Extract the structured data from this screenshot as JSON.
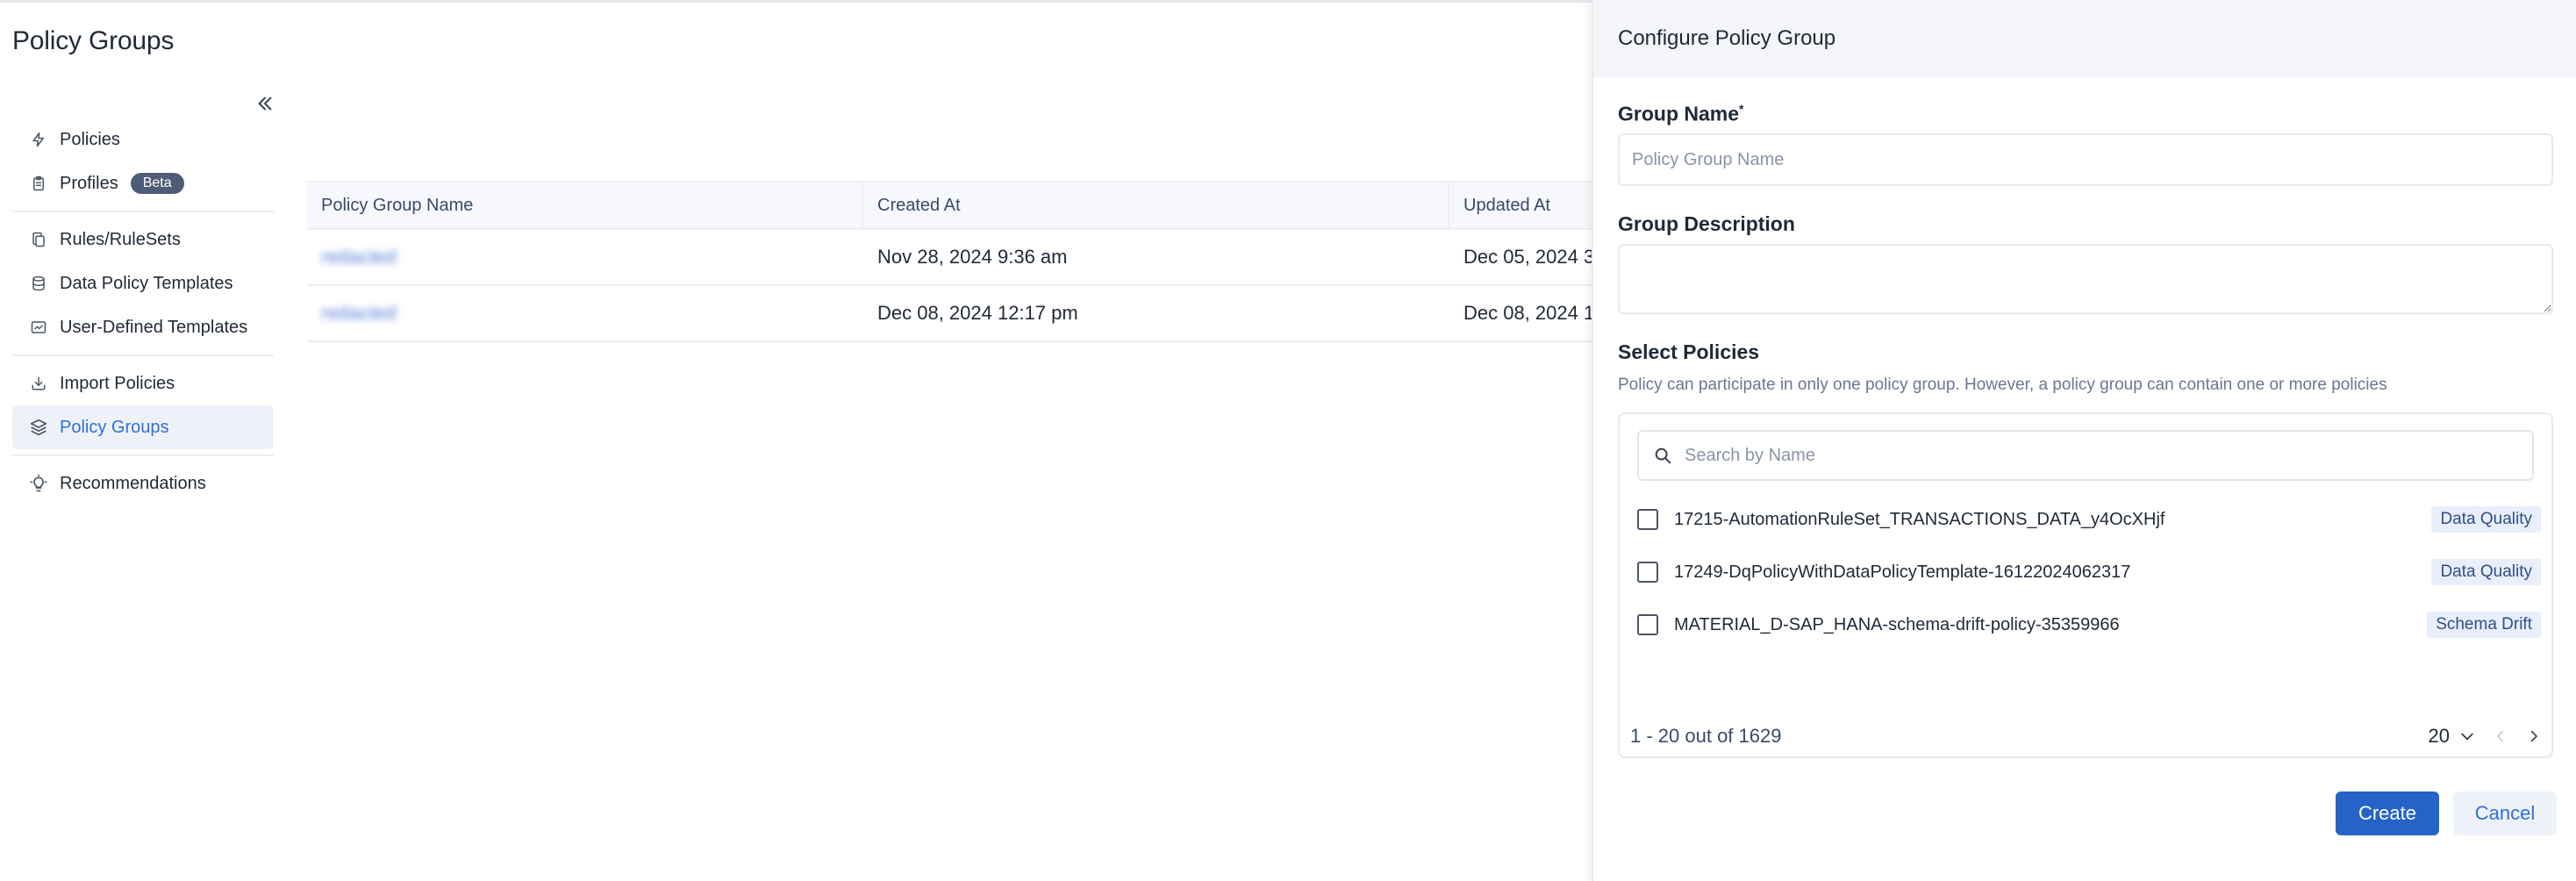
{
  "page": {
    "title": "Policy Groups"
  },
  "sidebar": {
    "items": [
      {
        "label": "Policies",
        "icon": "bolt-icon"
      },
      {
        "label": "Profiles",
        "icon": "clipboard-icon",
        "badge": "Beta"
      },
      {
        "label": "Rules/RuleSets",
        "icon": "copy-icon"
      },
      {
        "label": "Data Policy Templates",
        "icon": "database-icon"
      },
      {
        "label": "User-Defined Templates",
        "icon": "chart-card-icon"
      },
      {
        "label": "Import Policies",
        "icon": "import-icon"
      },
      {
        "label": "Policy Groups",
        "icon": "layers-icon",
        "active": true
      },
      {
        "label": "Recommendations",
        "icon": "lightbulb-icon"
      }
    ]
  },
  "table": {
    "headers": [
      "Policy Group Name",
      "Created At",
      "Updated At"
    ],
    "rows": [
      {
        "name": "redacted",
        "created": "Nov 28, 2024 9:36 am",
        "updated": "Dec 05, 2024 3"
      },
      {
        "name": "redacted",
        "created": "Dec 08, 2024 12:17 pm",
        "updated": "Dec 08, 2024 1"
      }
    ]
  },
  "panel": {
    "title": "Configure Policy Group",
    "group_name_label": "Group Name",
    "group_name_required": "*",
    "group_name_placeholder": "Policy Group Name",
    "group_name_value": "",
    "group_description_label": "Group Description",
    "group_description_value": "",
    "select_policies_label": "Select Policies",
    "select_policies_hint": "Policy can participate in only one policy group. However, a policy group can contain one or more policies",
    "search_placeholder": "Search by Name",
    "policies": [
      {
        "name": "17215-AutomationRuleSet_TRANSACTIONS_DATA_y4OcXHjf",
        "tag": "Data Quality"
      },
      {
        "name": "17249-DqPolicyWithDataPolicyTemplate-16122024062317",
        "tag": "Data Quality"
      },
      {
        "name": "MATERIAL_D-SAP_HANA-schema-drift-policy-35359966",
        "tag": "Schema Drift"
      }
    ],
    "pagination": {
      "range": "1 - 20 out of 1629",
      "page_size": "20"
    },
    "create_label": "Create",
    "cancel_label": "Cancel"
  },
  "colors": {
    "accent": "#2563c9",
    "active_nav_bg": "#eef2f8",
    "tag_bg": "#e8eefb"
  }
}
